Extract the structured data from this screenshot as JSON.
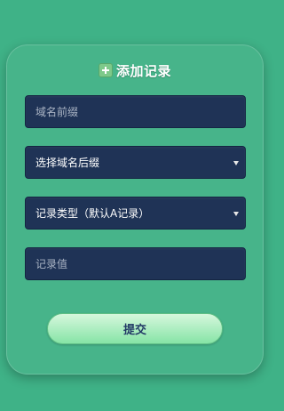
{
  "form": {
    "title": "添加记录",
    "title_icon": "plus-square-icon",
    "prefix_placeholder": "域名前缀",
    "suffix_selected": "选择域名后缀",
    "type_selected": "记录类型（默认A记录）",
    "value_placeholder": "记录值",
    "submit_label": "提交"
  },
  "colors": {
    "page_background": "#3fb287",
    "field_background": "#1f3356",
    "button_gradient_top": "#d6f7dd",
    "button_gradient_bottom": "#86e4a6",
    "button_text": "#233a66"
  }
}
